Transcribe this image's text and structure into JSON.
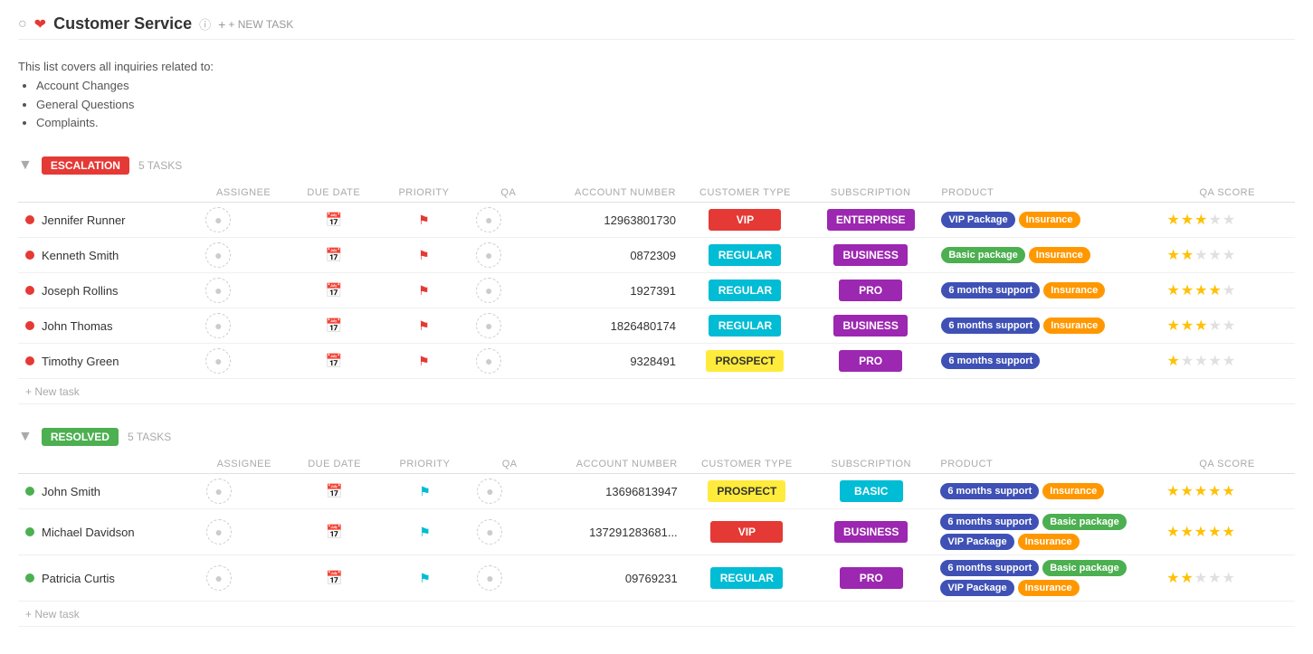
{
  "header": {
    "title": "Customer Service",
    "info_icon": "info-icon",
    "new_task_label": "+ NEW TASK"
  },
  "description": {
    "intro": "This list covers all inquiries related to:",
    "items": [
      "Account Changes",
      "General Questions",
      "Complaints."
    ]
  },
  "sections": [
    {
      "id": "escalation",
      "badge": "ESCALATION",
      "badge_class": "escalation",
      "task_count": "5 TASKS",
      "columns": {
        "assignee": "ASSIGNEE",
        "due_date": "DUE DATE",
        "priority": "PRIORITY",
        "qa": "QA",
        "account_number": "ACCOUNT NUMBER",
        "customer_type": "CUSTOMER TYPE",
        "subscription": "SUBSCRIPTION",
        "product": "PRODUCT",
        "qa_score": "QA SCORE"
      },
      "tasks": [
        {
          "name": "Jennifer Runner",
          "dot_class": "red",
          "account_number": "12963801730",
          "customer_type": "VIP",
          "customer_type_class": "vip",
          "subscription": "ENTERPRISE",
          "subscription_class": "enterprise",
          "products": [
            {
              "label": "VIP Package",
              "class": "vip-pkg"
            },
            {
              "label": "Insurance",
              "class": "insurance"
            }
          ],
          "stars_filled": 3,
          "stars_total": 5,
          "flag_class": "red",
          "flag_char": "⚑"
        },
        {
          "name": "Kenneth Smith",
          "dot_class": "red",
          "account_number": "0872309",
          "customer_type": "REGULAR",
          "customer_type_class": "regular",
          "subscription": "BUSINESS",
          "subscription_class": "business",
          "products": [
            {
              "label": "Basic package",
              "class": "basic-pkg"
            },
            {
              "label": "Insurance",
              "class": "insurance"
            }
          ],
          "stars_filled": 2,
          "stars_total": 5,
          "flag_class": "red",
          "flag_char": "⚑"
        },
        {
          "name": "Joseph Rollins",
          "dot_class": "red",
          "account_number": "1927391",
          "customer_type": "REGULAR",
          "customer_type_class": "regular",
          "subscription": "PRO",
          "subscription_class": "pro",
          "products": [
            {
              "label": "6 months support",
              "class": "support6"
            },
            {
              "label": "Insurance",
              "class": "insurance"
            }
          ],
          "stars_filled": 4,
          "stars_total": 5,
          "flag_class": "red",
          "flag_char": "⚑"
        },
        {
          "name": "John Thomas",
          "dot_class": "red",
          "account_number": "1826480174",
          "customer_type": "REGULAR",
          "customer_type_class": "regular",
          "subscription": "BUSINESS",
          "subscription_class": "business",
          "products": [
            {
              "label": "6 months support",
              "class": "support6"
            },
            {
              "label": "Insurance",
              "class": "insurance"
            }
          ],
          "stars_filled": 3,
          "stars_total": 5,
          "flag_class": "red",
          "flag_char": "⚑"
        },
        {
          "name": "Timothy Green",
          "dot_class": "red",
          "account_number": "9328491",
          "customer_type": "PROSPECT",
          "customer_type_class": "prospect",
          "subscription": "PRO",
          "subscription_class": "pro",
          "products": [
            {
              "label": "6 months support",
              "class": "support6"
            }
          ],
          "stars_filled": 1,
          "stars_total": 5,
          "flag_class": "red",
          "flag_char": "⚑"
        }
      ],
      "new_task_label": "+ New task"
    },
    {
      "id": "resolved",
      "badge": "RESOLVED",
      "badge_class": "resolved",
      "task_count": "5 TASKS",
      "columns": {
        "assignee": "ASSIGNEE",
        "due_date": "DUE DATE",
        "priority": "PRIORITY",
        "qa": "QA",
        "account_number": "ACCOUNT NUMBER",
        "customer_type": "CUSTOMER TYPE",
        "subscription": "SUBSCRIPTION",
        "product": "PRODUCT",
        "qa_score": "QA SCORE"
      },
      "tasks": [
        {
          "name": "John Smith",
          "dot_class": "green",
          "account_number": "13696813947",
          "customer_type": "PROSPECT",
          "customer_type_class": "prospect",
          "subscription": "BASIC",
          "subscription_class": "basic",
          "products": [
            {
              "label": "6 months support",
              "class": "support6"
            },
            {
              "label": "Insurance",
              "class": "insurance"
            }
          ],
          "stars_filled": 5,
          "stars_total": 5,
          "flag_class": "cyan",
          "flag_char": "⚑"
        },
        {
          "name": "Michael Davidson",
          "dot_class": "green",
          "account_number": "137291283681...",
          "customer_type": "VIP",
          "customer_type_class": "vip",
          "subscription": "BUSINESS",
          "subscription_class": "business",
          "products": [
            {
              "label": "6 months support",
              "class": "support6"
            },
            {
              "label": "Basic package",
              "class": "basic-pkg"
            },
            {
              "label": "VIP Package",
              "class": "vip-pkg"
            },
            {
              "label": "Insurance",
              "class": "insurance"
            }
          ],
          "stars_filled": 5,
          "stars_total": 5,
          "flag_class": "cyan",
          "flag_char": "⚑"
        },
        {
          "name": "Patricia Curtis",
          "dot_class": "green",
          "account_number": "09769231",
          "customer_type": "REGULAR",
          "customer_type_class": "regular",
          "subscription": "PRO",
          "subscription_class": "pro",
          "products": [
            {
              "label": "6 months support",
              "class": "support6"
            },
            {
              "label": "Basic package",
              "class": "basic-pkg"
            },
            {
              "label": "VIP Package",
              "class": "vip-pkg"
            },
            {
              "label": "Insurance",
              "class": "insurance"
            }
          ],
          "stars_filled": 2,
          "stars_total": 5,
          "flag_class": "cyan",
          "flag_char": "⚑"
        }
      ],
      "new_task_label": "+ New task"
    }
  ]
}
